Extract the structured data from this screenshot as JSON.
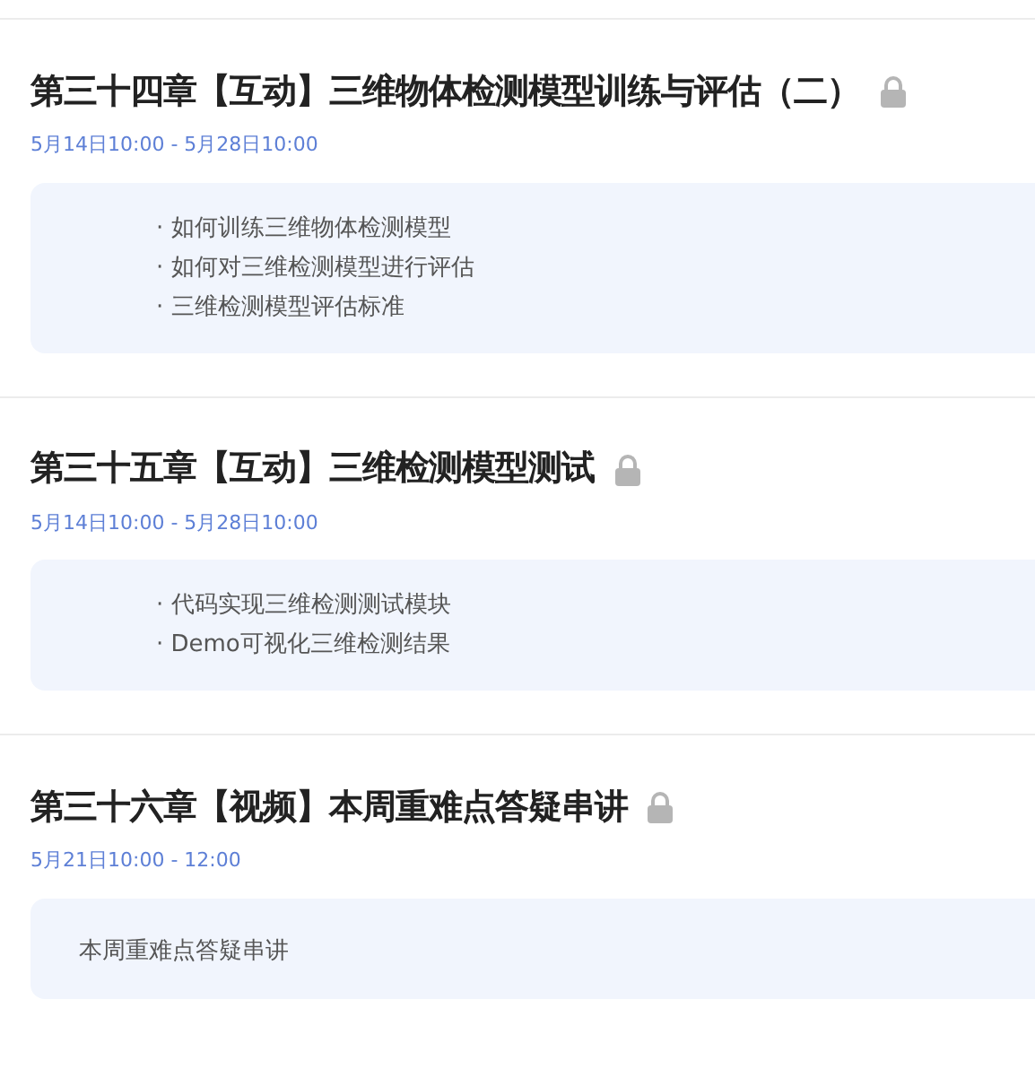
{
  "chapters": [
    {
      "title": "第三十四章【互动】三维物体检测模型训练与评估（二）",
      "locked": true,
      "date": "5月14日10:00 - 5月28日10:00",
      "content": {
        "kind": "list",
        "items": [
          "· 如何训练三维物体检测模型",
          "· 如何对三维检测模型进行评估",
          "· 三维检测模型评估标准"
        ]
      }
    },
    {
      "title": "第三十五章【互动】三维检测模型测试",
      "locked": true,
      "date": "5月14日10:00 - 5月28日10:00",
      "content": {
        "kind": "list",
        "items": [
          "· 代码实现三维检测测试模块",
          "· Demo可视化三维检测结果"
        ]
      }
    },
    {
      "title": "第三十六章【视频】本周重难点答疑串讲",
      "locked": true,
      "date": "5月21日10:00 - 12:00",
      "content": {
        "kind": "text",
        "text": "本周重难点答疑串讲"
      }
    }
  ]
}
